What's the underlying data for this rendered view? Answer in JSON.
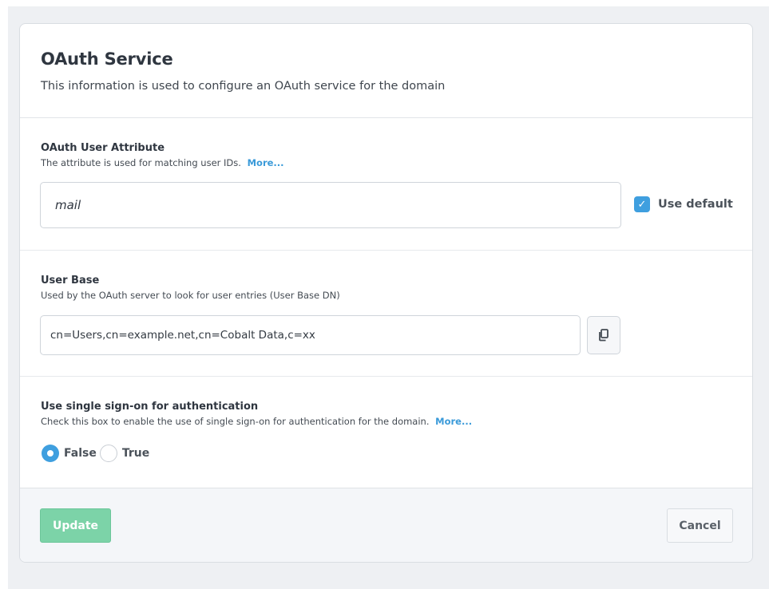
{
  "header": {
    "title": "OAuth Service",
    "description": "This information is used to configure an OAuth service for the domain"
  },
  "oauth_user_attribute": {
    "label": "OAuth User Attribute",
    "hint": "The attribute is used for matching user IDs.",
    "more_link": "More...",
    "value": "mail",
    "use_default_label": "Use default",
    "use_default_checked": true
  },
  "user_base": {
    "label": "User Base",
    "hint": "Used by the OAuth server to look for user entries (User Base DN)",
    "value": "cn=Users,cn=example.net,cn=Cobalt Data,c=xx",
    "copy_icon": "copy-icon"
  },
  "sso": {
    "label": "Use single sign-on for authentication",
    "hint": "Check this box to enable the use of single sign-on for authentication for the domain.",
    "more_link": "More...",
    "options": [
      "False",
      "True"
    ],
    "selected": "False"
  },
  "footer": {
    "update_label": "Update",
    "cancel_label": "Cancel"
  },
  "colors": {
    "accent": "#3f9fdf",
    "update_button": "#7cd3a8",
    "link": "#3a9ad9"
  }
}
